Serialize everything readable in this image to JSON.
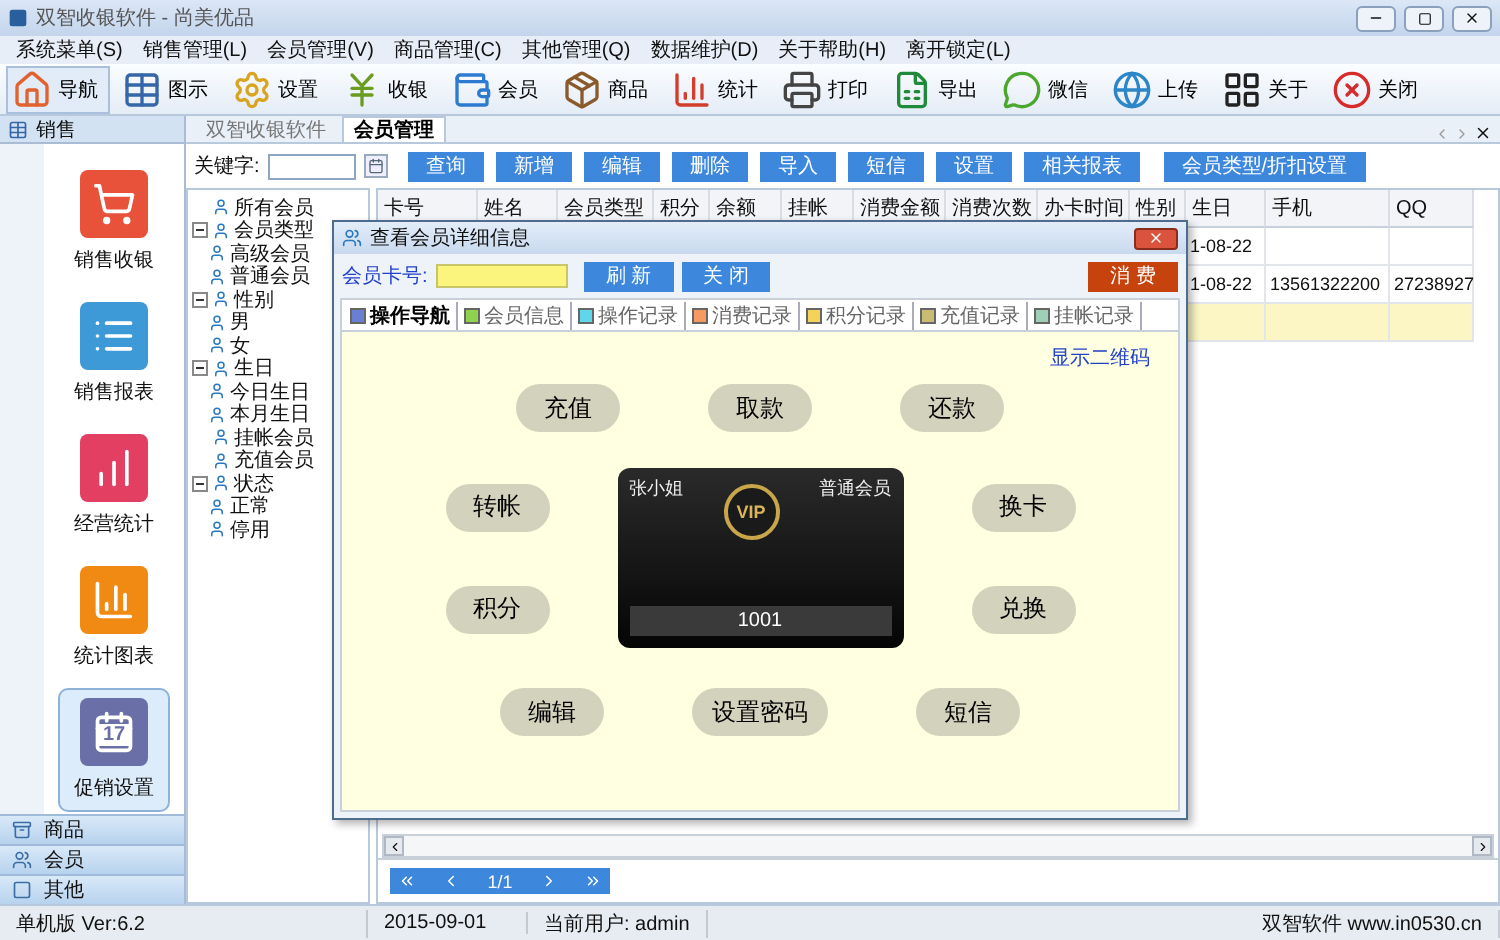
{
  "window": {
    "title": "双智收银软件 - 尚美优品"
  },
  "menu": [
    "系统菜单(S)",
    "销售管理(L)",
    "会员管理(V)",
    "商品管理(C)",
    "其他管理(Q)",
    "数据维护(D)",
    "关于帮助(H)",
    "离开锁定(L)"
  ],
  "toolbar": [
    {
      "label": "导航",
      "selected": true
    },
    {
      "label": "图示",
      "selected": false
    },
    {
      "label": "设置",
      "selected": false
    },
    {
      "label": "收银",
      "selected": false
    },
    {
      "label": "会员",
      "selected": false
    },
    {
      "label": "商品",
      "selected": false
    },
    {
      "label": "统计",
      "selected": false
    },
    {
      "label": "打印",
      "selected": false
    },
    {
      "label": "导出",
      "selected": false
    },
    {
      "label": "微信",
      "selected": false
    },
    {
      "label": "上传",
      "selected": false
    },
    {
      "label": "关于",
      "selected": false
    },
    {
      "label": "关闭",
      "selected": false
    }
  ],
  "sidebar": {
    "header": "销售",
    "items": [
      {
        "label": "销售收银",
        "color": "#e8513a",
        "selected": false
      },
      {
        "label": "销售报表",
        "color": "#3d9ad6",
        "selected": false
      },
      {
        "label": "经营统计",
        "color": "#e23f63",
        "selected": false
      },
      {
        "label": "统计图表",
        "color": "#f18a12",
        "selected": false
      },
      {
        "label": "促销设置",
        "color": "#6b6fa8",
        "selected": true,
        "icon_text": "17"
      }
    ],
    "sections": [
      "商品",
      "会员",
      "其他"
    ]
  },
  "doc_tabs": [
    {
      "label": "双智收银软件",
      "selected": false
    },
    {
      "label": "会员管理",
      "selected": true
    }
  ],
  "search": {
    "label": "关键字:"
  },
  "actions": [
    "查询",
    "新增",
    "编辑",
    "删除",
    "导入",
    "短信",
    "设置",
    "相关报表",
    "会员类型/折扣设置"
  ],
  "tree": [
    {
      "label": "所有会员"
    },
    {
      "label": "会员类型",
      "expanded": true,
      "children": [
        {
          "label": "高级会员"
        },
        {
          "label": "普通会员"
        }
      ]
    },
    {
      "label": "性别",
      "expanded": true,
      "children": [
        {
          "label": "男"
        },
        {
          "label": "女"
        }
      ]
    },
    {
      "label": "生日",
      "expanded": true,
      "children": [
        {
          "label": "今日生日"
        },
        {
          "label": "本月生日"
        }
      ]
    },
    {
      "label": "挂帐会员"
    },
    {
      "label": "充值会员"
    },
    {
      "label": "状态",
      "expanded": true,
      "children": [
        {
          "label": "正常"
        },
        {
          "label": "停用"
        }
      ]
    }
  ],
  "table": {
    "columns": [
      "卡号",
      "姓名",
      "会员类型",
      "积分",
      "余额",
      "挂帐",
      "消费金额",
      "消费次数",
      "办卡时间",
      "性别",
      "生日",
      "手机",
      "QQ"
    ],
    "rows": [
      {
        "selected": false,
        "birthday": "1-08-22"
      },
      {
        "selected": false,
        "birthday": "1-08-22",
        "phone": "13561322200",
        "qq": "27238927"
      },
      {
        "selected": true
      }
    ]
  },
  "pager": {
    "page": "1/1"
  },
  "dialog": {
    "title": "查看会员详细信息",
    "card_label": "会员卡号:",
    "buttons": [
      "刷 新",
      "关 闭"
    ],
    "primary": "消 费",
    "tabs": [
      {
        "label": "操作导航",
        "selected": true,
        "color": "#6a7fd4"
      },
      {
        "label": "会员信息",
        "selected": false,
        "color": "#8fd04e"
      },
      {
        "label": "操作记录",
        "selected": false,
        "color": "#5fd6ea"
      },
      {
        "label": "消费记录",
        "selected": false,
        "color": "#f59a63"
      },
      {
        "label": "积分记录",
        "selected": false,
        "color": "#f4d35b"
      },
      {
        "label": "充值记录",
        "selected": false,
        "color": "#c9bc72"
      },
      {
        "label": "挂帐记录",
        "selected": false,
        "color": "#9ed0b8"
      }
    ],
    "qr_link": "显示二维码",
    "top_actions": [
      "充值",
      "取款",
      "还款"
    ],
    "left_actions": [
      "转帐",
      "积分"
    ],
    "right_actions": [
      "换卡",
      "兑换"
    ],
    "bottom_actions": [
      "编辑",
      "设置密码",
      "短信"
    ],
    "member_card": {
      "name": "张小姐",
      "type": "普通会员",
      "badge": "VIP",
      "number": "1001"
    }
  },
  "status_bar": {
    "version": "单机版 Ver:6.2",
    "date": "2015-09-01",
    "user": "当前用户: admin",
    "vendor": "双智软件 www.in0530.cn"
  }
}
